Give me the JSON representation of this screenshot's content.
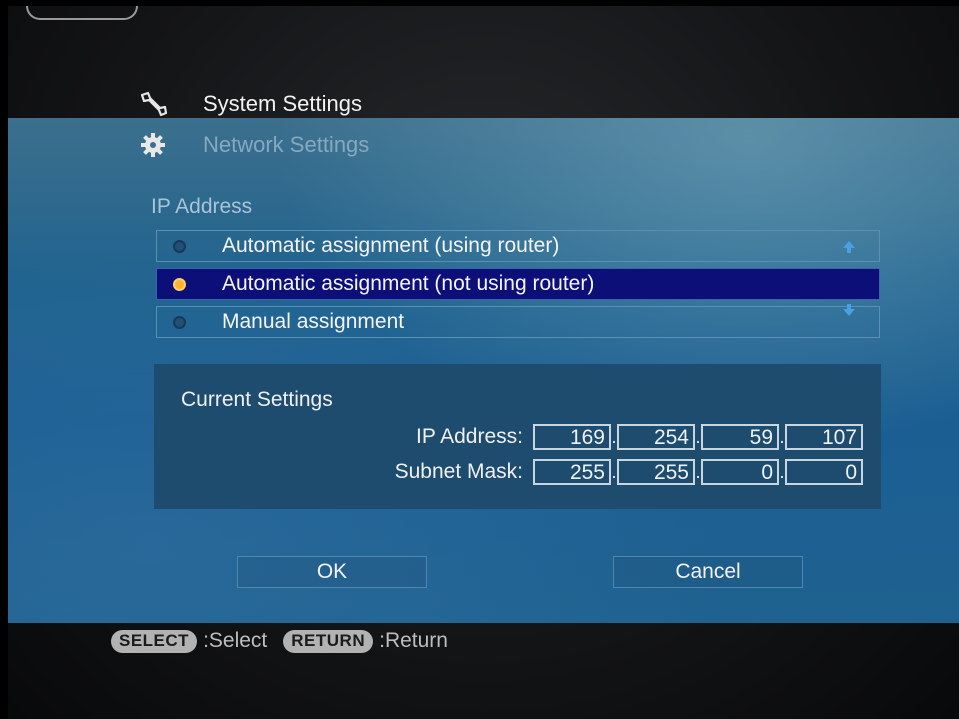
{
  "header": {
    "system_title": "System Settings",
    "system_icon": "wrench-icon",
    "network_title": "Network Settings",
    "network_icon": "gear-icon"
  },
  "ip_section": {
    "label": "IP Address",
    "options": [
      {
        "label": "Automatic assignment (using router)",
        "selected": false
      },
      {
        "label": "Automatic assignment (not using router)",
        "selected": true
      },
      {
        "label": "Manual assignment",
        "selected": false
      }
    ]
  },
  "current_settings": {
    "title": "Current Settings",
    "ip_label": "IP Address:",
    "ip": [
      "169",
      "254",
      "59",
      "107"
    ],
    "subnet_label": "Subnet Mask:",
    "subnet": [
      "255",
      "255",
      "0",
      "0"
    ]
  },
  "buttons": {
    "ok": "OK",
    "cancel": "Cancel"
  },
  "footer": {
    "select_key": "SELECT",
    "select_hint": ":Select",
    "return_key": "RETURN",
    "return_hint": ":Return"
  },
  "colors": {
    "selected_row": "#0d0f79",
    "radio_on": "#ffb42e",
    "panel": "#1f6290"
  }
}
